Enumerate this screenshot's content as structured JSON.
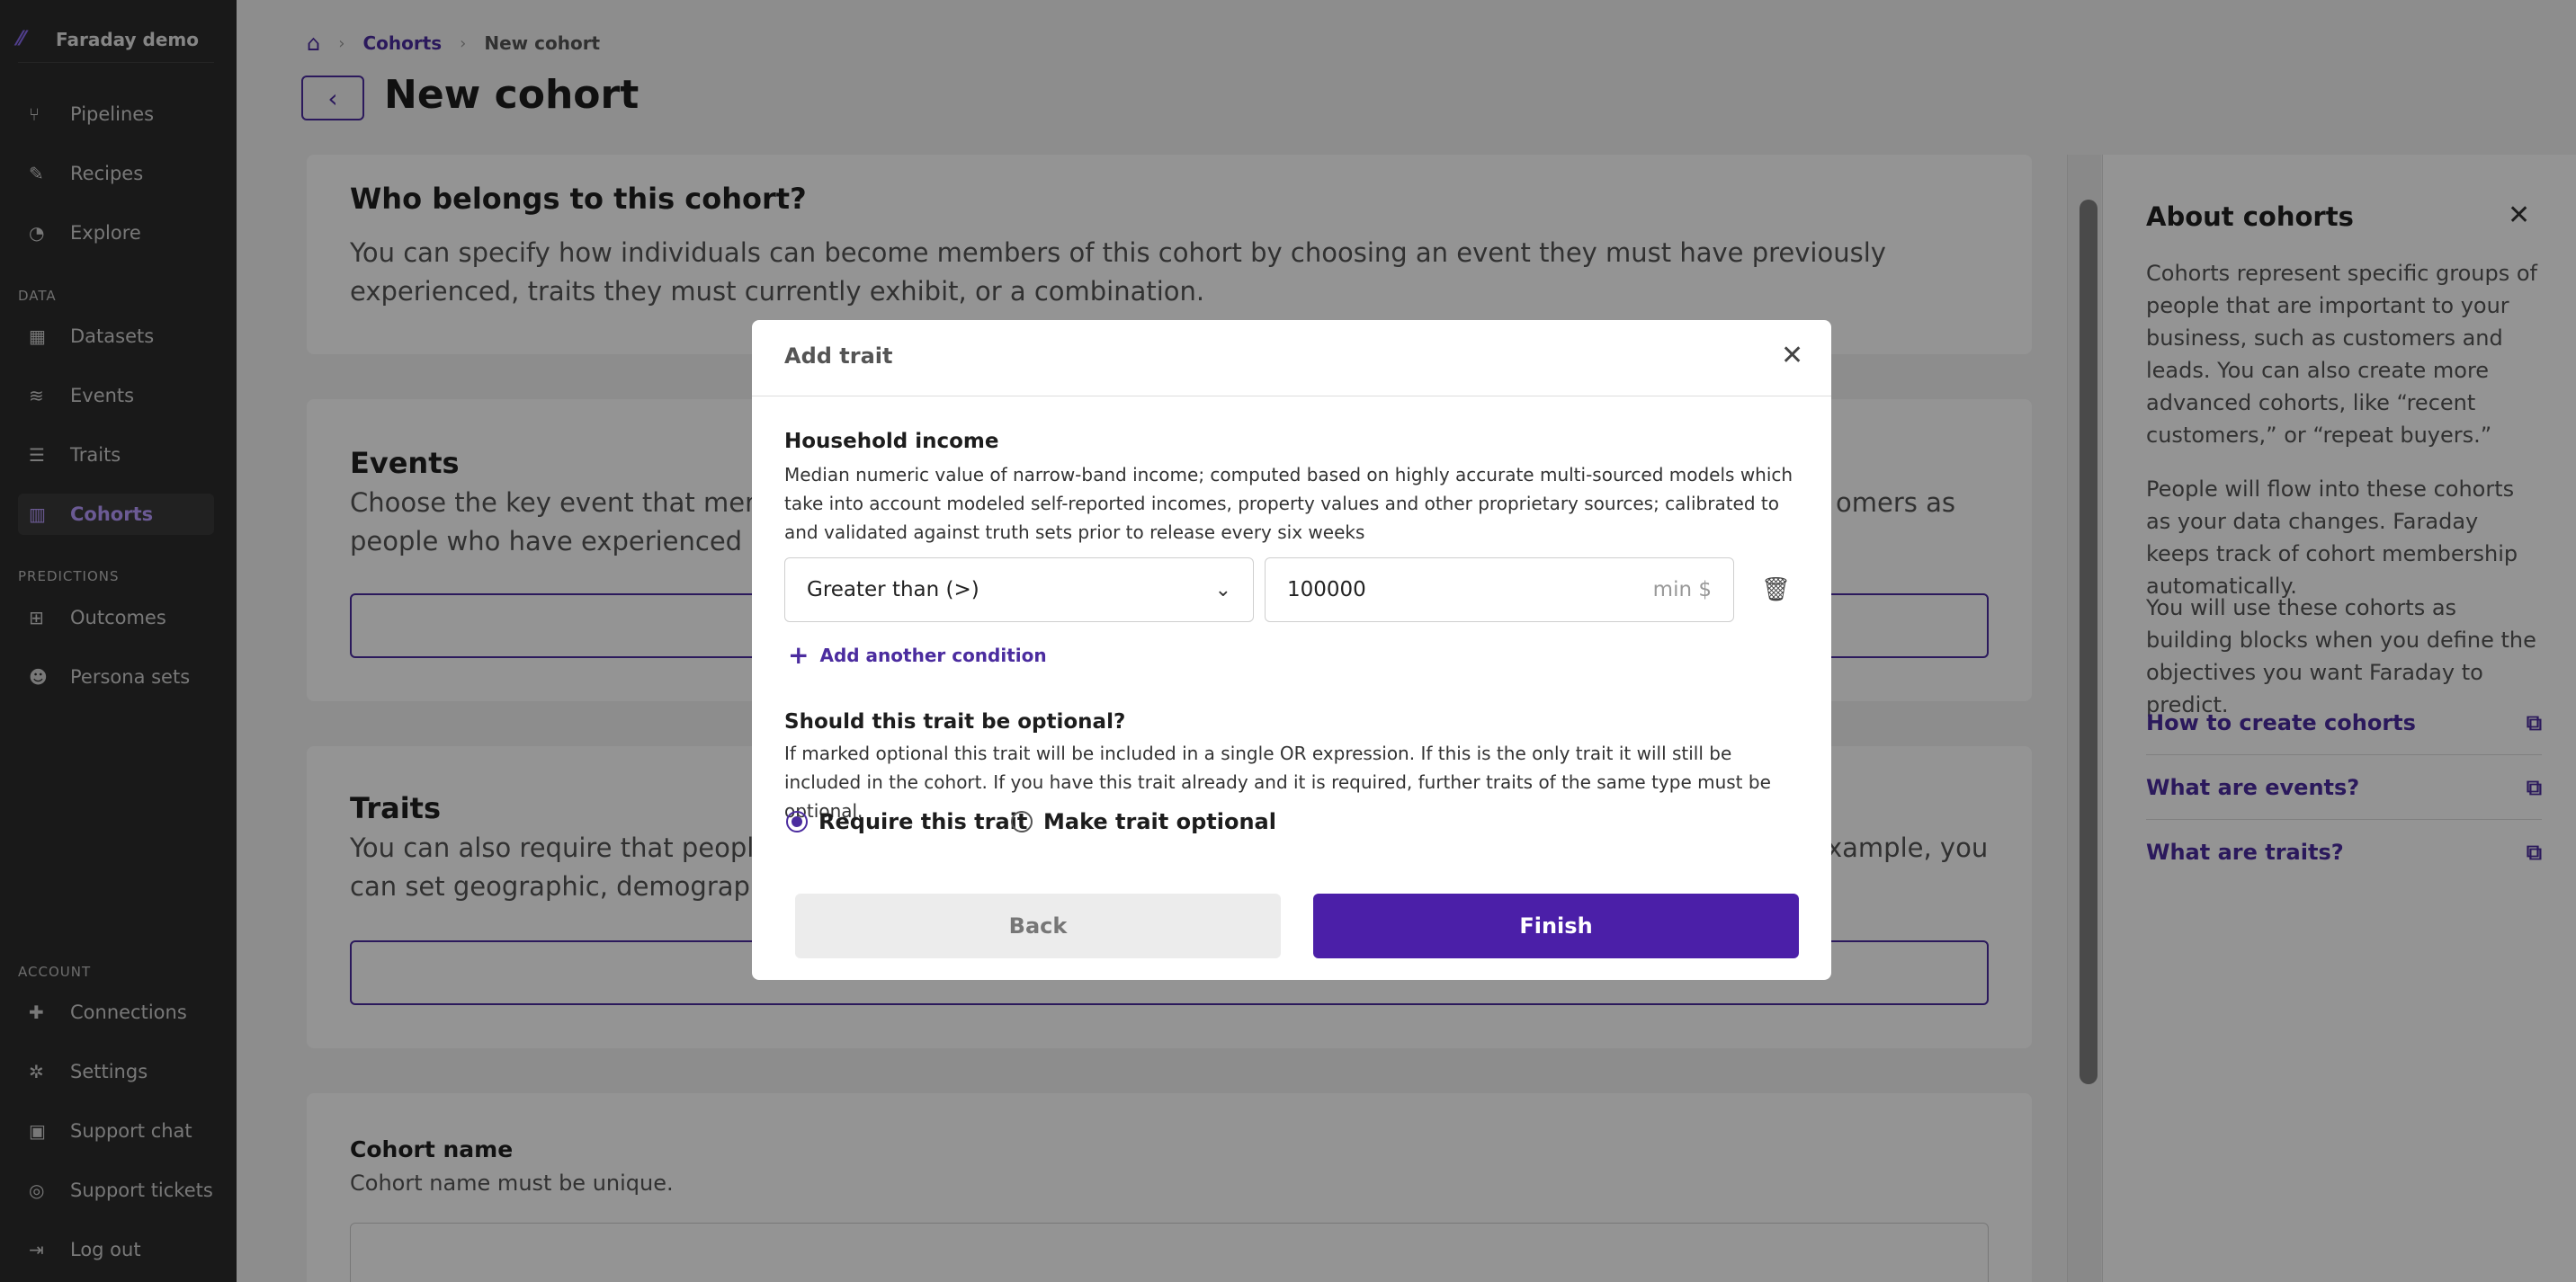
{
  "app": {
    "name": "Faraday demo"
  },
  "sidebar": {
    "primary": [
      {
        "label": "Pipelines",
        "icon": "pipelines-icon"
      },
      {
        "label": "Recipes",
        "icon": "recipes-icon"
      },
      {
        "label": "Explore",
        "icon": "explore-icon"
      }
    ],
    "data_label": "DATA",
    "data": [
      {
        "label": "Datasets",
        "icon": "datasets-icon"
      },
      {
        "label": "Events",
        "icon": "events-icon"
      },
      {
        "label": "Traits",
        "icon": "traits-icon"
      },
      {
        "label": "Cohorts",
        "icon": "cohorts-icon",
        "active": true
      }
    ],
    "predictions_label": "PREDICTIONS",
    "predictions": [
      {
        "label": "Outcomes",
        "icon": "outcomes-icon"
      },
      {
        "label": "Persona sets",
        "icon": "persona-sets-icon"
      }
    ],
    "account_label": "ACCOUNT",
    "account": [
      {
        "label": "Connections",
        "icon": "connections-icon"
      },
      {
        "label": "Settings",
        "icon": "settings-icon"
      },
      {
        "label": "Support chat",
        "icon": "support-chat-icon"
      },
      {
        "label": "Support tickets",
        "icon": "support-tickets-icon"
      },
      {
        "label": "Log out",
        "icon": "logout-icon"
      }
    ]
  },
  "breadcrumb": {
    "parent": "Cohorts",
    "current": "New cohort"
  },
  "page": {
    "title": "New cohort"
  },
  "sections": {
    "who": {
      "title": "Who belongs to this cohort?",
      "description": "You can specify how individuals can become members of this cohort by choosing an event they must have previously experienced, traits they must currently exhibit, or a combination."
    },
    "events": {
      "title": "Events",
      "description_left": "Choose the key event that membe",
      "description_right": "omers as",
      "description_line2": "people who have experienced an o"
    },
    "traits": {
      "title": "Traits",
      "description_left": "You can also require that people cu",
      "description_right": "xample, you",
      "description_line2": "can set geographic, demographic,"
    },
    "cohort_name": {
      "title": "Cohort name",
      "description": "Cohort name must be unique."
    }
  },
  "about": {
    "title": "About cohorts",
    "p1": "Cohorts represent specific groups of people that are important to your business, such as customers and leads. You can also create more advanced cohorts, like “recent customers,” or “repeat buyers.”",
    "p2": "People will flow into these cohorts as your data changes. Faraday keeps track of cohort membership automatically.",
    "p3": "You will use these cohorts as building blocks when you define the objectives you want Faraday to predict.",
    "links": [
      "How to create cohorts",
      "What are events?",
      "What are traits?"
    ]
  },
  "modal": {
    "title": "Add trait",
    "trait_name": "Household income",
    "trait_description": "Median numeric value of narrow-band income; computed based on highly accurate multi-sourced models which take into account modeled self-reported incomes, property values and other proprietary sources; calibrated to and validated against truth sets prior to release every six weeks",
    "operator": "Greater than (>)",
    "value": "100000",
    "unit": "min $",
    "add_condition": "Add another condition",
    "optional_title": "Should this trait be optional?",
    "optional_description": "If marked optional this trait will be included in a single OR expression. If this is the only trait it will still be included in the cohort. If you have this trait already and it is required, further traits of the same type must be optional.",
    "require_label": "Require this trait",
    "optional_label": "Make trait optional",
    "selected": "require",
    "back_label": "Back",
    "finish_label": "Finish"
  },
  "colors": {
    "accent": "#4b1fa8",
    "sidebar": "#2b2b2b",
    "link": "#4b2c9f"
  }
}
